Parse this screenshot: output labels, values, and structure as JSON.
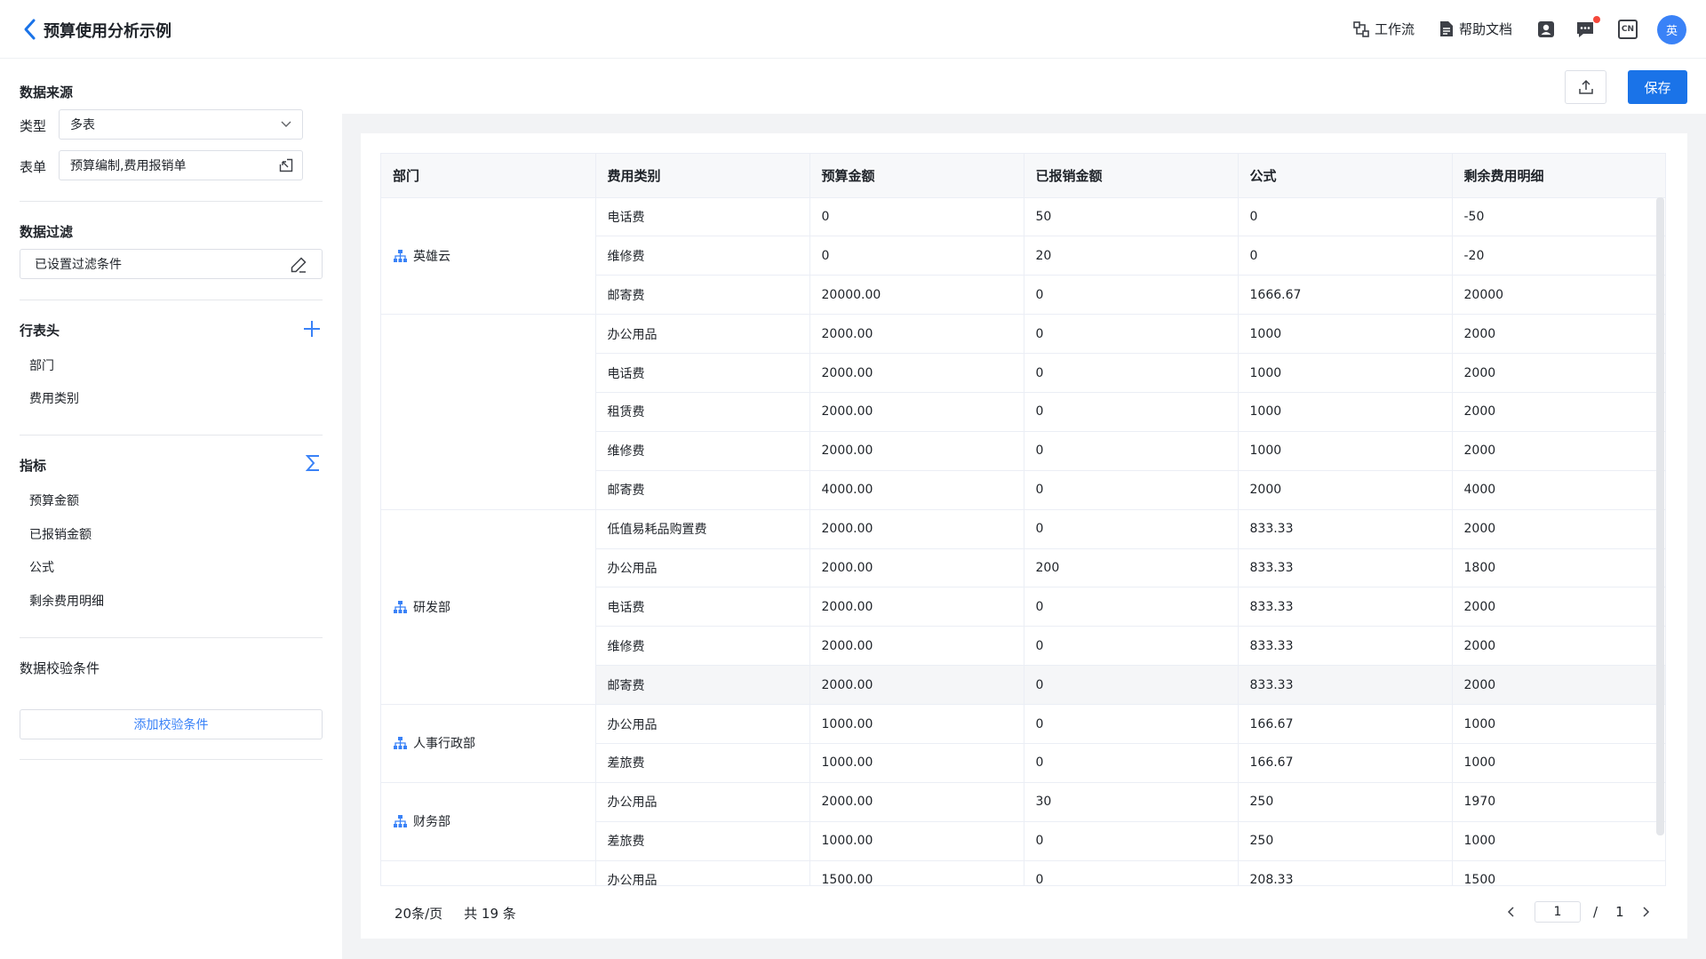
{
  "header": {
    "title": "预算使用分析示例",
    "workflow_label": "工作流",
    "help_label": "帮助文档",
    "lang_badge": "CN",
    "avatar_text": "英"
  },
  "sidebar": {
    "datasource": {
      "title": "数据来源",
      "type_label": "类型",
      "type_value": "多表",
      "form_label": "表单",
      "form_value": "预算编制,费用报销单"
    },
    "filter": {
      "title": "数据过滤",
      "value": "已设置过滤条件"
    },
    "row_header": {
      "title": "行表头",
      "items": [
        "部门",
        "费用类别"
      ]
    },
    "metrics": {
      "title": "指标",
      "items": [
        "预算金额",
        "已报销金额",
        "公式",
        "剩余费用明细"
      ]
    },
    "validation": {
      "title": "数据校验条件",
      "add_label": "添加校验条件"
    }
  },
  "toolbar": {
    "save_label": "保存"
  },
  "table": {
    "columns": [
      "部门",
      "费用类别",
      "预算金额",
      "已报销金额",
      "公式",
      "剩余费用明细"
    ],
    "groups": [
      {
        "dept": "英雄云",
        "rows": [
          [
            "电话费",
            "0",
            "50",
            "0",
            "-50"
          ],
          [
            "维修费",
            "0",
            "20",
            "0",
            "-20"
          ],
          [
            "邮寄费",
            "20000.00",
            "0",
            "1666.67",
            "20000"
          ]
        ]
      },
      {
        "dept": "",
        "rows": [
          [
            "办公用品",
            "2000.00",
            "0",
            "1000",
            "2000"
          ],
          [
            "电话费",
            "2000.00",
            "0",
            "1000",
            "2000"
          ],
          [
            "租赁费",
            "2000.00",
            "0",
            "1000",
            "2000"
          ],
          [
            "维修费",
            "2000.00",
            "0",
            "1000",
            "2000"
          ],
          [
            "邮寄费",
            "4000.00",
            "0",
            "2000",
            "4000"
          ]
        ]
      },
      {
        "dept": "研发部",
        "rows": [
          [
            "低值易耗品购置费",
            "2000.00",
            "0",
            "833.33",
            "2000"
          ],
          [
            "办公用品",
            "2000.00",
            "200",
            "833.33",
            "1800"
          ],
          [
            "电话费",
            "2000.00",
            "0",
            "833.33",
            "2000"
          ],
          [
            "维修费",
            "2000.00",
            "0",
            "833.33",
            "2000"
          ],
          [
            "邮寄费",
            "2000.00",
            "0",
            "833.33",
            "2000"
          ]
        ]
      },
      {
        "dept": "人事行政部",
        "rows": [
          [
            "办公用品",
            "1000.00",
            "0",
            "166.67",
            "1000"
          ],
          [
            "差旅费",
            "1000.00",
            "0",
            "166.67",
            "1000"
          ]
        ]
      },
      {
        "dept": "财务部",
        "rows": [
          [
            "办公用品",
            "2000.00",
            "30",
            "250",
            "1970"
          ],
          [
            "差旅费",
            "1000.00",
            "0",
            "250",
            "1000"
          ]
        ]
      },
      {
        "dept": "",
        "rows": [
          [
            "办公用品",
            "1500.00",
            "0",
            "208.33",
            "1500"
          ]
        ]
      }
    ]
  },
  "pagination": {
    "page_size": "20条/页",
    "total": "共 19 条",
    "current_page": "1",
    "separator": "/",
    "total_pages": "1"
  },
  "colors": {
    "primary": "#1a73e8",
    "icon_blue": "#3a82f7",
    "badge_red": "#f5483b"
  }
}
